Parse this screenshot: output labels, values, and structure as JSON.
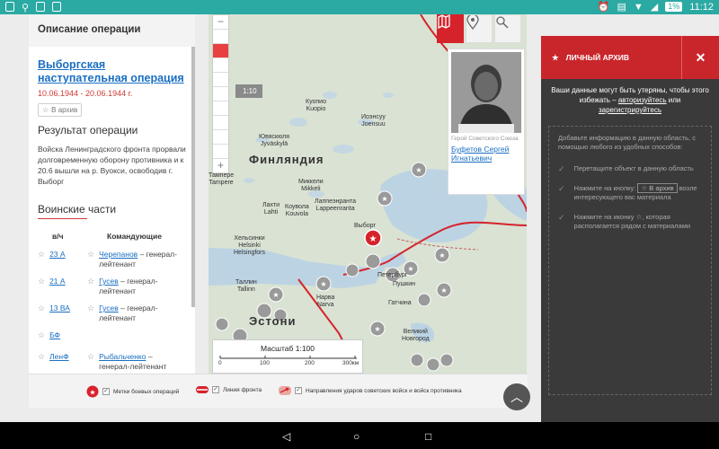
{
  "status": {
    "time": "11:12",
    "battery": "1%"
  },
  "left": {
    "header": "Описание операции",
    "op_title": "Выборгская наступательная операция",
    "op_dates": "10.06.1944 - 20.06.1944 г.",
    "archive_label": "В архив",
    "result_title": "Результат операции",
    "result_text": "Войска Ленинградского фронта прорвали долговременную оборону противника и к 20.6 вышли на р. Вуокси, освободив г. Выборг",
    "units_title": "Воинские части",
    "col_unit": "в/ч",
    "col_cmdr": "Командующие",
    "units": [
      {
        "unit": "23 А",
        "cmdr": "Черепанов",
        "rank": "– генерал-лейтенант"
      },
      {
        "unit": "21 А",
        "cmdr": "Гусев",
        "rank": "– генерал-лейтенант"
      },
      {
        "unit": "13 ВА",
        "cmdr": "Гусев",
        "rank": "– генерал-лейтенант"
      },
      {
        "unit": "БФ",
        "cmdr": "",
        "rank": ""
      },
      {
        "unit": "ЛенФ",
        "cmdr": "Рыбальченко",
        "rank": "– генерал-лейтенант"
      }
    ]
  },
  "map": {
    "scale_tag": "1:10",
    "country_finland": "Финляндия",
    "country_estonia": "Эстони",
    "labels": [
      "Куопио\nKuopio",
      "Иоэнсуу\nJoensuu",
      "Ювяскюля\nJyväskylä",
      "Тампере\nTampere",
      "Миккели\nMikkeli",
      "Лаппеэнранта\nLappeenranta",
      "Лахти\nLahti",
      "Коувола\nKouvola",
      "Хельсинки\nHelsinki\nHelsingfors",
      "Таллин\nTallinn",
      "Выборг",
      "Петербург",
      "Пушкин",
      "Гатчина",
      "Нарва\nNarva",
      "Великий\nНовгород"
    ],
    "hero_caption": "Герой Советского Союза",
    "hero_name": "Буфетов Сергей Игнатьевич",
    "scale_title": "Масштаб 1:100",
    "scale_ticks": [
      "0",
      "100",
      "200",
      "300км"
    ]
  },
  "legend": {
    "ops": "Метки боевых операций",
    "front": "Линия фронта",
    "strikes": "Направления ударов советских войск и войск противника"
  },
  "archive": {
    "title": "ЛИЧНЫЙ АРХИВ",
    "warn_pre": "Ваши данные могут быть утеряны, чтобы этого избежать –",
    "auth": "авторизуйтесь",
    "or": "или",
    "reg": "зарегистрируйтесь",
    "intro": "Добавьте информацию в данную область, с помощью любого из удобных способов:",
    "step1": "Перетащите объект в данную область",
    "step2_pre": "Нажмите на кнопку:",
    "step2_btn": "В архив",
    "step2_post": "возле интересующего вас материала",
    "step3": "Нажмите на иконку ☆, которая располагается рядом с материалами"
  }
}
